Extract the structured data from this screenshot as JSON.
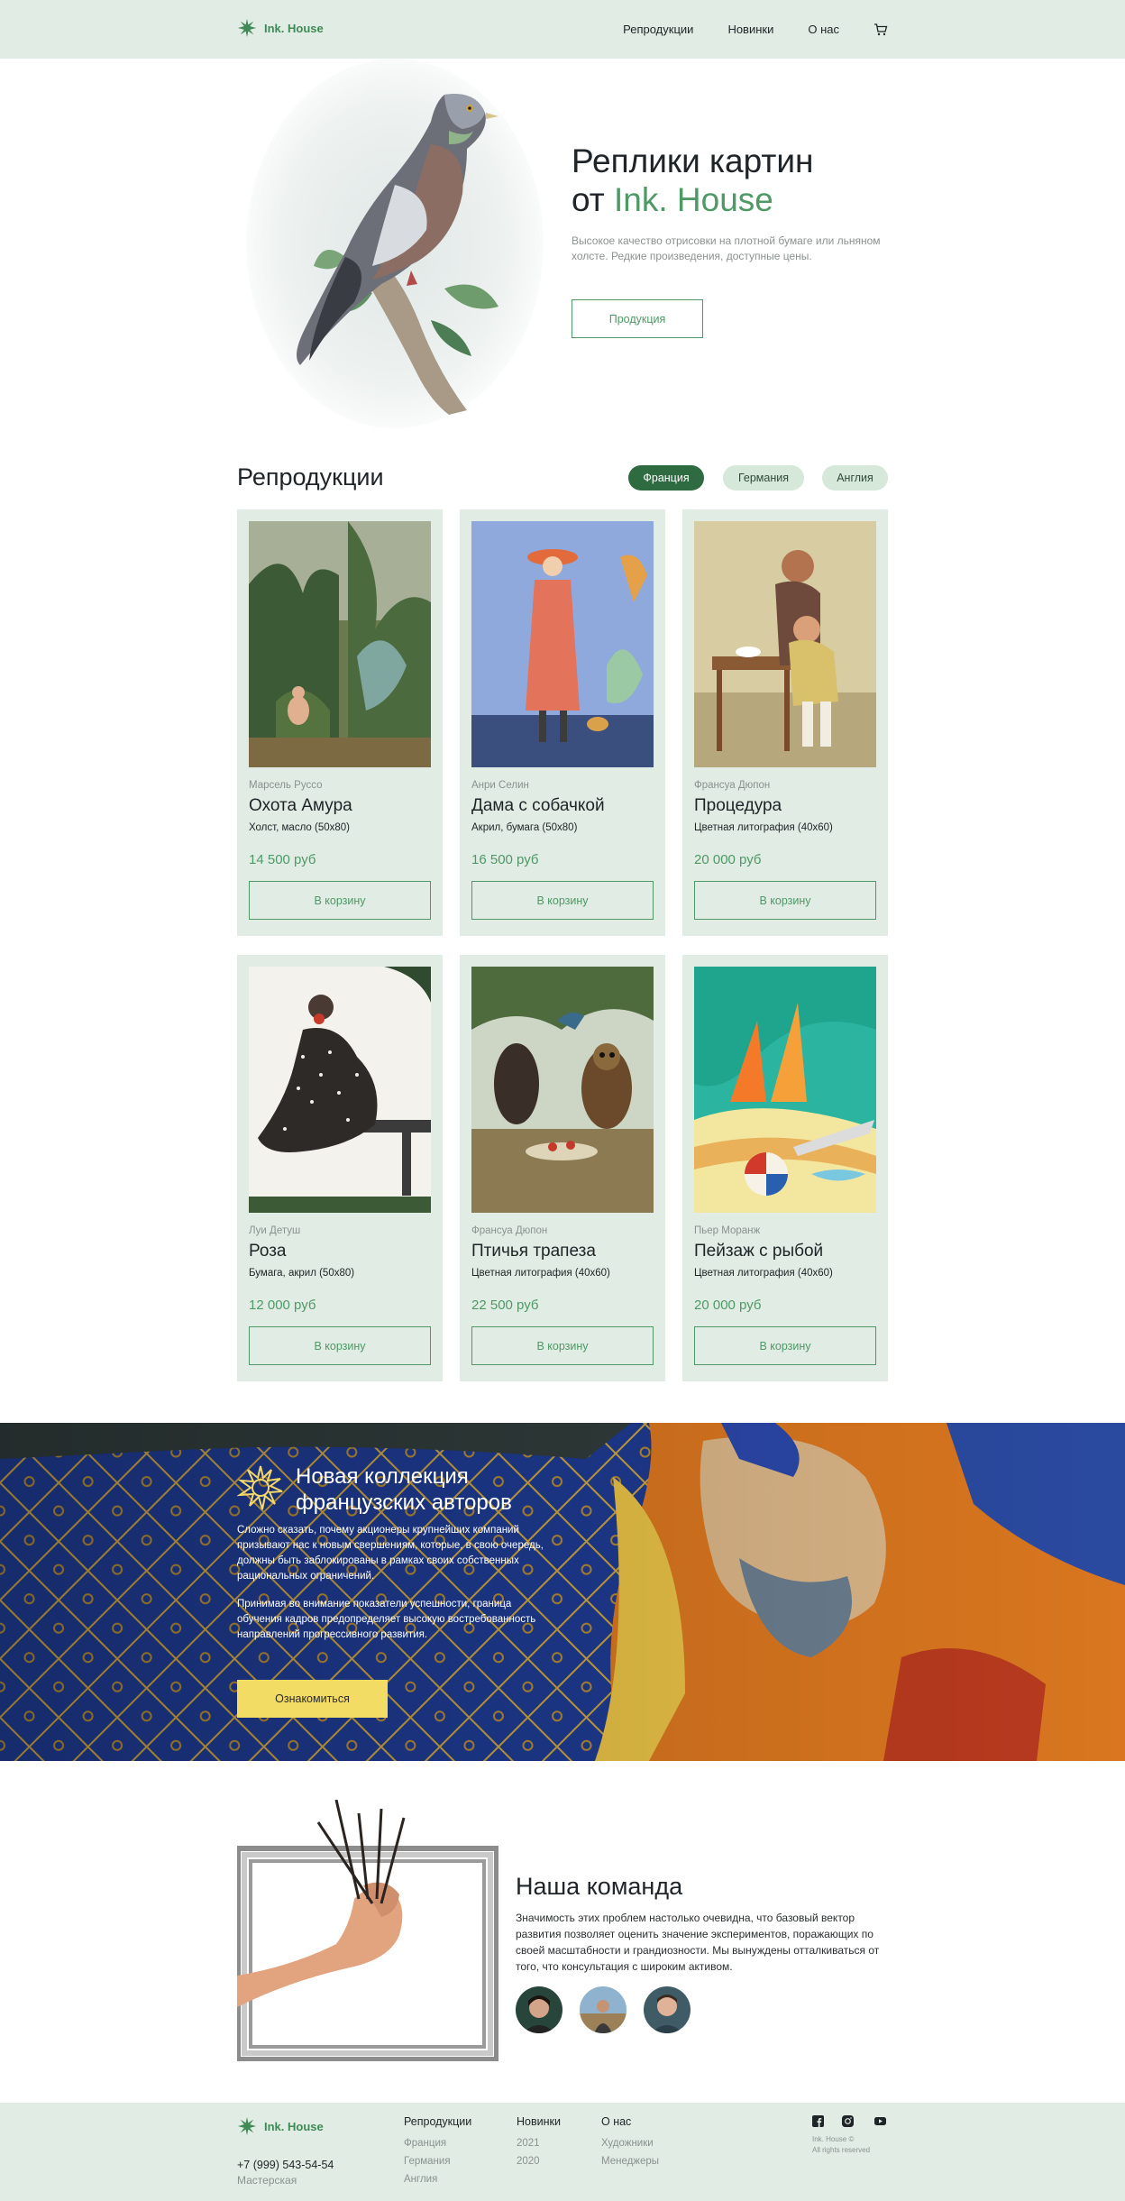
{
  "brand": {
    "name": "Ink. House",
    "color": "#4e9966"
  },
  "nav": {
    "items": [
      "Репродукции",
      "Новинки",
      "О нас"
    ],
    "cart_icon": "cart-icon"
  },
  "hero": {
    "title_line1": "Реплики картин",
    "title_prefix": "от ",
    "title_accent": "Ink. House",
    "subtitle": "Высокое качество отрисовки на плотной бумаге или льняном холсте. Редкие произведения, доступные цены.",
    "button": "Продукция"
  },
  "products": {
    "title": "Репродукции",
    "filters": [
      {
        "label": "Франция",
        "active": true
      },
      {
        "label": "Германия",
        "active": false
      },
      {
        "label": "Англия",
        "active": false
      }
    ],
    "items": [
      {
        "artist": "Марсель Руссо",
        "name": "Охота Амура",
        "medium": "Холст, масло (50х80)",
        "price": "14 500 руб",
        "button": "В корзину"
      },
      {
        "artist": "Анри Селин",
        "name": "Дама с собачкой",
        "medium": "Акрил, бумага (50х80)",
        "price": "16 500 руб",
        "button": "В корзину"
      },
      {
        "artist": "Франсуа Дюпон",
        "name": "Процедура",
        "medium": "Цветная литография (40х60)",
        "price": "20 000 руб",
        "button": "В корзину"
      },
      {
        "artist": "Луи Детуш",
        "name": "Роза",
        "medium": "Бумага, акрил (50х80)",
        "price": "12 000 руб",
        "button": "В корзину"
      },
      {
        "artist": "Франсуа Дюпон",
        "name": "Птичья трапеза",
        "medium": "Цветная литография (40х60)",
        "price": "22 500 руб",
        "button": "В корзину"
      },
      {
        "artist": "Пьер Моранж",
        "name": "Пейзаж с рыбой",
        "medium": "Цветная литография (40х60)",
        "price": "20 000 руб",
        "button": "В корзину"
      }
    ]
  },
  "banner": {
    "title": "Новая коллекция французских авторов",
    "p1": "Сложно сказать, почему акционеры крупнейших компаний призывают нас к новым свершениям, которые, в свою очередь, должны быть заблокированы в рамках своих собственных рациональных ограничений.",
    "p2": "Принимая во внимание показатели успешности, граница обучения кадров предопределяет высокую востребованность направлений прогрессивного развития.",
    "button": "Ознакомиться"
  },
  "team": {
    "title": "Наша команда",
    "text": "Значимость этих проблем настолько очевидна, что базовый вектор развития позволяет оценить значение экспериментов, поражающих по своей масштабности и грандиозности. Мы вынуждены отталкиваться от того, что консультация с широким активом."
  },
  "footer": {
    "phone": "+7 (999) 543-54-54",
    "workshop": "Мастерская",
    "col1": {
      "title": "Репродукции",
      "links": [
        "Франция",
        "Германия",
        "Англия"
      ]
    },
    "col2": {
      "title": "Новинки",
      "links": [
        "2021",
        "2020"
      ]
    },
    "col3": {
      "title": "О нас",
      "links": [
        "Художники",
        "Менеджеры"
      ]
    },
    "copyright": "Ink. House ©",
    "rights": "All rights reserved",
    "social_icons": [
      "facebook-icon",
      "instagram-icon",
      "youtube-icon"
    ]
  }
}
